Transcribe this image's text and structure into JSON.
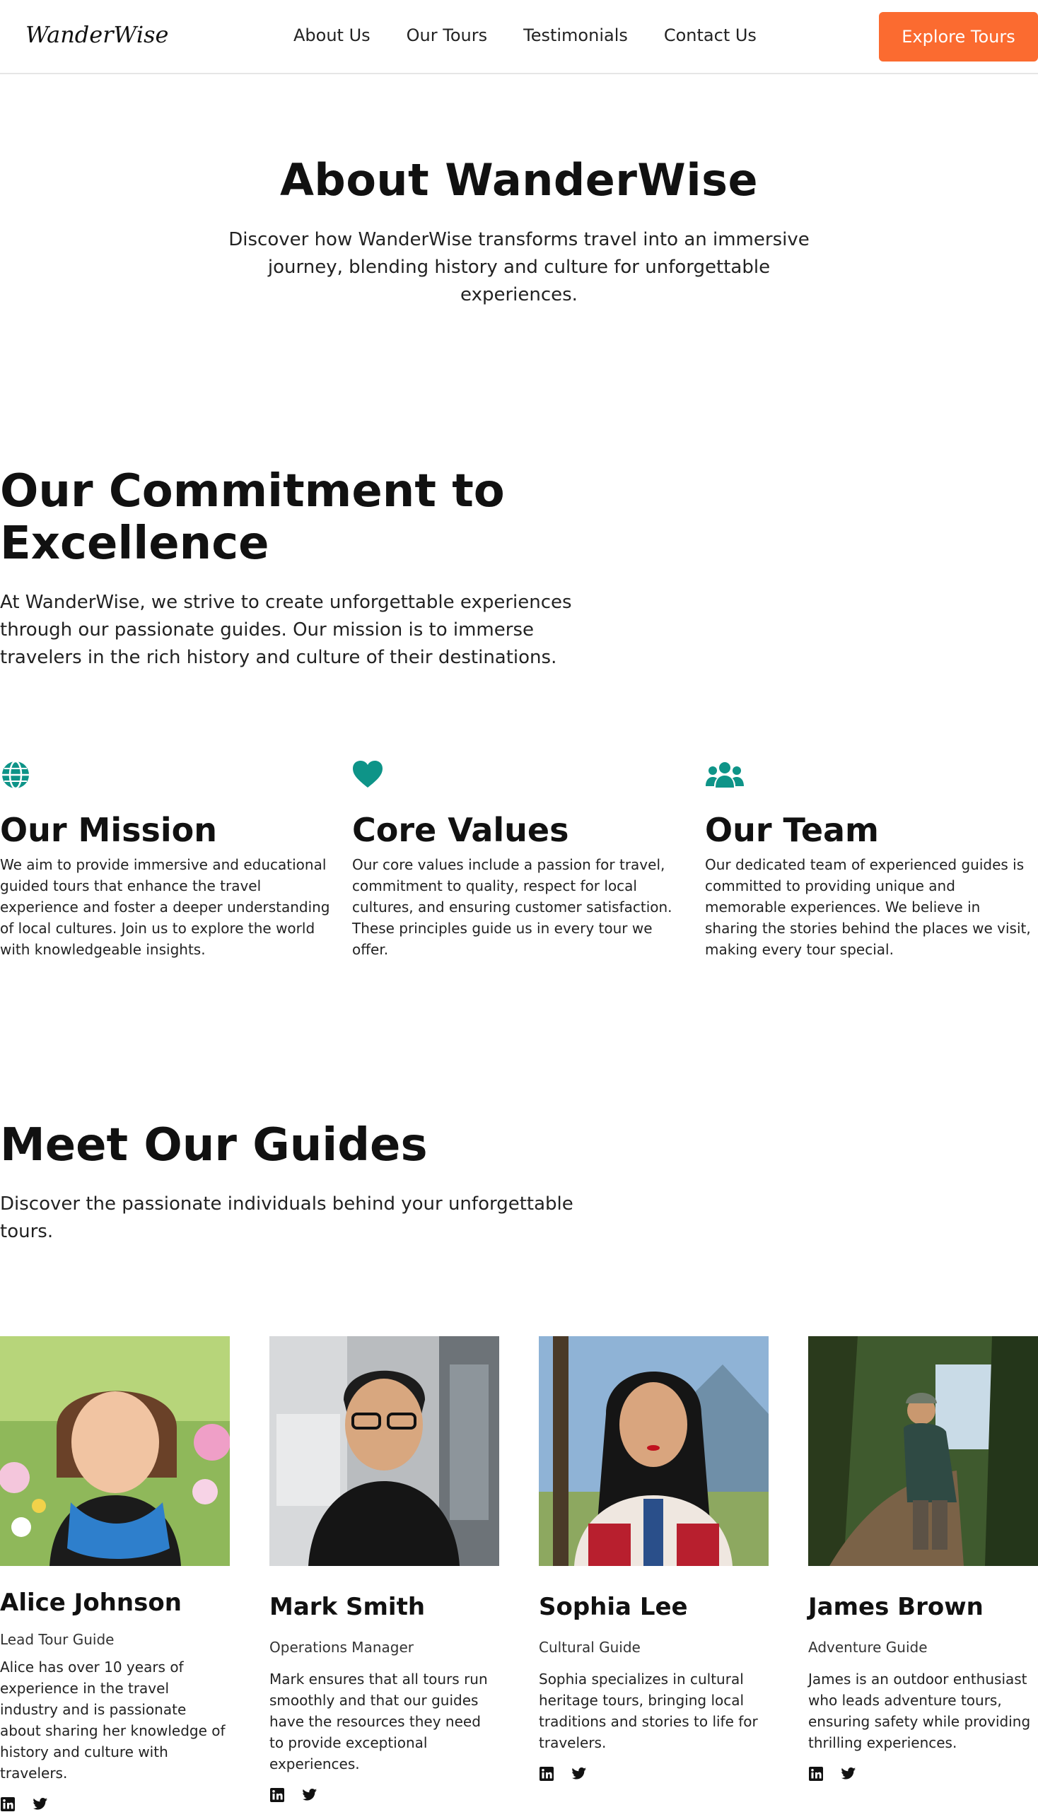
{
  "header": {
    "logo": "WanderWise",
    "nav": [
      "About Us",
      "Our Tours",
      "Testimonials",
      "Contact Us"
    ],
    "cta": "Explore Tours"
  },
  "hero": {
    "title": "About WanderWise",
    "subtitle": "Discover how WanderWise transforms travel into an immersive journey, blending history and culture for unforgettable experiences."
  },
  "commitment": {
    "title": "Our Commitment to Excellence",
    "body": "At WanderWise, we strive to create unforgettable experiences through our passionate guides. Our mission is to immerse travelers in the rich history and culture of their destinations.",
    "features": [
      {
        "icon": "globe-icon",
        "title": "Our Mission",
        "body": "We aim to provide immersive and educational guided tours that enhance the travel experience and foster a deeper understanding of local cultures. Join us to explore the world with knowledgeable insights."
      },
      {
        "icon": "heart-icon",
        "title": "Core Values",
        "body": "Our core values include a passion for travel, commitment to quality, respect for local cultures, and ensuring customer satisfaction. These principles guide us in every tour we offer."
      },
      {
        "icon": "users-icon",
        "title": "Our Team",
        "body": "Our dedicated team of experienced guides is committed to providing unique and memorable experiences. We believe in sharing the stories behind the places we visit, making every tour special."
      }
    ]
  },
  "guides": {
    "title": "Meet Our Guides",
    "subtitle": "Discover the passionate individuals behind your unforgettable tours.",
    "members": [
      {
        "name": "Alice Johnson",
        "role": "Lead Tour Guide",
        "bio": "Alice has over 10 years of experience in the travel industry and is passionate about sharing her knowledge of history and culture with travelers."
      },
      {
        "name": "Mark Smith",
        "role": "Operations Manager",
        "bio": "Mark ensures that all tours run smoothly and that our guides have the resources they need to provide exceptional experiences."
      },
      {
        "name": "Sophia Lee",
        "role": "Cultural Guide",
        "bio": "Sophia specializes in cultural heritage tours, bringing local traditions and stories to life for travelers."
      },
      {
        "name": "James Brown",
        "role": "Adventure Guide",
        "bio": "James is an outdoor enthusiast who leads adventure tours, ensuring safety while providing thrilling experiences."
      }
    ],
    "social_icons": [
      "linkedin-icon",
      "twitter-icon"
    ]
  },
  "colors": {
    "accent": "#fb6b30",
    "icon_teal": "#0e9488",
    "text": "#111111"
  }
}
